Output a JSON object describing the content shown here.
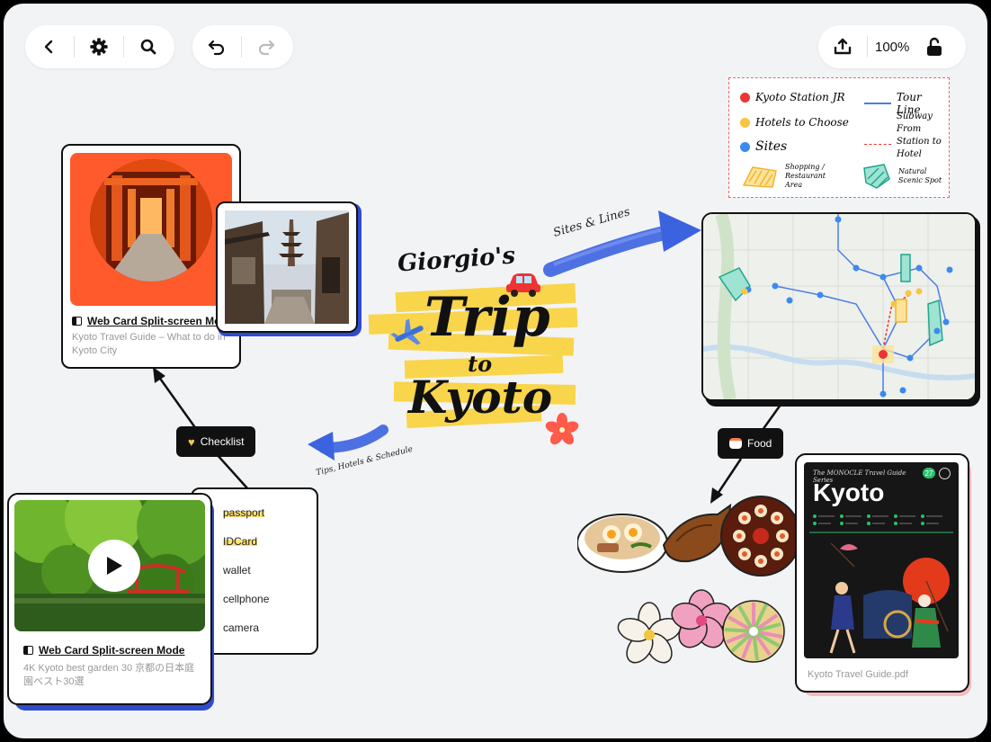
{
  "toolbar": {
    "zoom": "100%"
  },
  "center": {
    "author": "Giorgio's",
    "word1": "Trip",
    "word2": "to",
    "word3": "Kyoto"
  },
  "annotations": {
    "sites_lines": "Sites & Lines",
    "tips": "Tips, Hotels & Schedule"
  },
  "legend": {
    "station": "Kyoto Station JR",
    "hotels": "Hotels to Choose",
    "sites": "Sites",
    "shopping": "Shopping / Restaurant Area",
    "tour_line": "Tour Line",
    "subway": "Subway From Station to Hotel",
    "natural": "Natural Scenic Spot"
  },
  "card_torii": {
    "title": "Web Card Split-screen Mode",
    "subtitle": "Kyoto Travel Guide – What to do in Kyoto City"
  },
  "card_video": {
    "title": "Web Card Split-screen Mode",
    "subtitle": "4K Kyoto best garden 30 京都の日本庭園ベスト30選"
  },
  "tags": {
    "checklist": "Checklist",
    "food": "Food"
  },
  "checklist": {
    "items": [
      "passport",
      "IDCard",
      "wallet",
      "cellphone",
      "camera"
    ]
  },
  "guide": {
    "header": "The MONOCLE Travel Guide Series",
    "number": "27",
    "title": "Kyoto",
    "filename": "Kyoto Travel Guide.pdf"
  },
  "colors": {
    "accent_blue": "#3b63e0",
    "torii_orange": "#ff5a2c",
    "highlight_yellow": "#f9d33c"
  }
}
